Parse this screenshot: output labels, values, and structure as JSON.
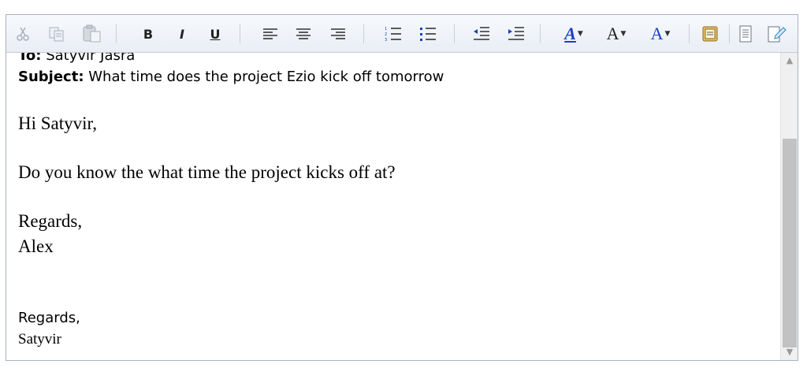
{
  "toolbar": {
    "buttons": [
      {
        "name": "cut-button",
        "icon": "cut-icon",
        "glyph": "✂"
      },
      {
        "name": "copy-button",
        "icon": "copy-icon",
        "glyph": "⧉"
      },
      {
        "name": "paste-button",
        "icon": "paste-icon",
        "glyph": "📋"
      },
      {
        "name": "bold-button",
        "icon": "bold-icon",
        "glyph": "B"
      },
      {
        "name": "italic-button",
        "icon": "italic-icon",
        "glyph": "I"
      },
      {
        "name": "underline-button",
        "icon": "underline-icon",
        "glyph": "U"
      },
      {
        "name": "align-left-button",
        "icon": "align-left-icon",
        "glyph": "≡"
      },
      {
        "name": "align-center-button",
        "icon": "align-center-icon",
        "glyph": "≡"
      },
      {
        "name": "align-right-button",
        "icon": "align-right-icon",
        "glyph": "≡"
      },
      {
        "name": "numbered-list-button",
        "icon": "numbered-list-icon",
        "glyph": "☰"
      },
      {
        "name": "bullet-list-button",
        "icon": "bullet-list-icon",
        "glyph": "☰"
      },
      {
        "name": "decrease-indent-button",
        "icon": "decrease-indent-icon",
        "glyph": "⇤"
      },
      {
        "name": "increase-indent-button",
        "icon": "increase-indent-icon",
        "glyph": "⇥"
      },
      {
        "name": "highlight-color-button",
        "icon": "highlight-color-icon",
        "glyph": "A"
      },
      {
        "name": "font-size-button",
        "icon": "font-size-icon",
        "glyph": "A"
      },
      {
        "name": "font-color-button",
        "icon": "font-color-icon",
        "glyph": "A"
      },
      {
        "name": "insert-image-button",
        "icon": "image-icon",
        "glyph": "▣"
      },
      {
        "name": "document-button",
        "icon": "document-icon",
        "glyph": "▤"
      },
      {
        "name": "edit-document-button",
        "icon": "edit-document-icon",
        "glyph": "✎"
      }
    ],
    "colors": {
      "font_blue": "#1a3fbf",
      "highlight_blue": "#1a3fbf",
      "disabled": "#a8b0bd"
    }
  },
  "email": {
    "to_label": "To:",
    "to_value": "Satyvir Jasra",
    "subject_label": "Subject:",
    "subject_value": "What time does the project Ezio kick off tomorrow",
    "greeting": "Hi Satyvir,",
    "question": "Do you know the what time the project kicks off at?",
    "closing": "Regards,",
    "sender": "Alex",
    "sig_closing": "Regards,",
    "sig_name": "Satyvir"
  }
}
